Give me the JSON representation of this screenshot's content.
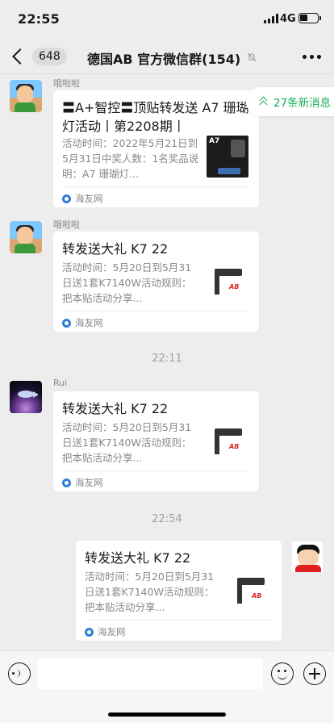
{
  "status_bar": {
    "time": "22:55",
    "network": "4G"
  },
  "header": {
    "back_count": "648",
    "title": "德国AB 官方微信群(154)",
    "mute_icon": "bell-slash-icon"
  },
  "new_messages": {
    "label": "27条新消息"
  },
  "messages": [
    {
      "sender": "哦啦啦",
      "title": "〓A+智控〓顶贴转发送 A7 珊瑚灯活动丨第2208期丨",
      "desc": "活动时间：2022年5月21日到5月31日中奖人数：1名奖品说明：A7 珊瑚灯...",
      "thumb_label": "A7",
      "source": "海友网"
    },
    {
      "sender": "哦啦啦",
      "title": "转发送大礼 K7 22",
      "desc": "活动时间：5月20日到5月31日送1套K7140W活动规则：把本贴活动分享...",
      "thumb_label": "AB",
      "source": "海友网"
    },
    {
      "timestamp": "22:11",
      "sender": "Rui",
      "title": "转发送大礼 K7 22",
      "desc": "活动时间：5月20日到5月31日送1套K7140W活动规则：把本贴活动分享...",
      "thumb_label": "AB",
      "source": "海友网"
    },
    {
      "timestamp": "22:54",
      "title": "转发送大礼 K7 22",
      "desc": "活动时间：5月20日到5月31日送1套K7140W活动规则：把本贴活动分享...",
      "thumb_label": "AB",
      "source": "海友网"
    }
  ],
  "input_bar": {
    "placeholder": ""
  },
  "colors": {
    "background": "#ededed",
    "accent_green": "#1aad5c",
    "card": "#ffffff"
  }
}
